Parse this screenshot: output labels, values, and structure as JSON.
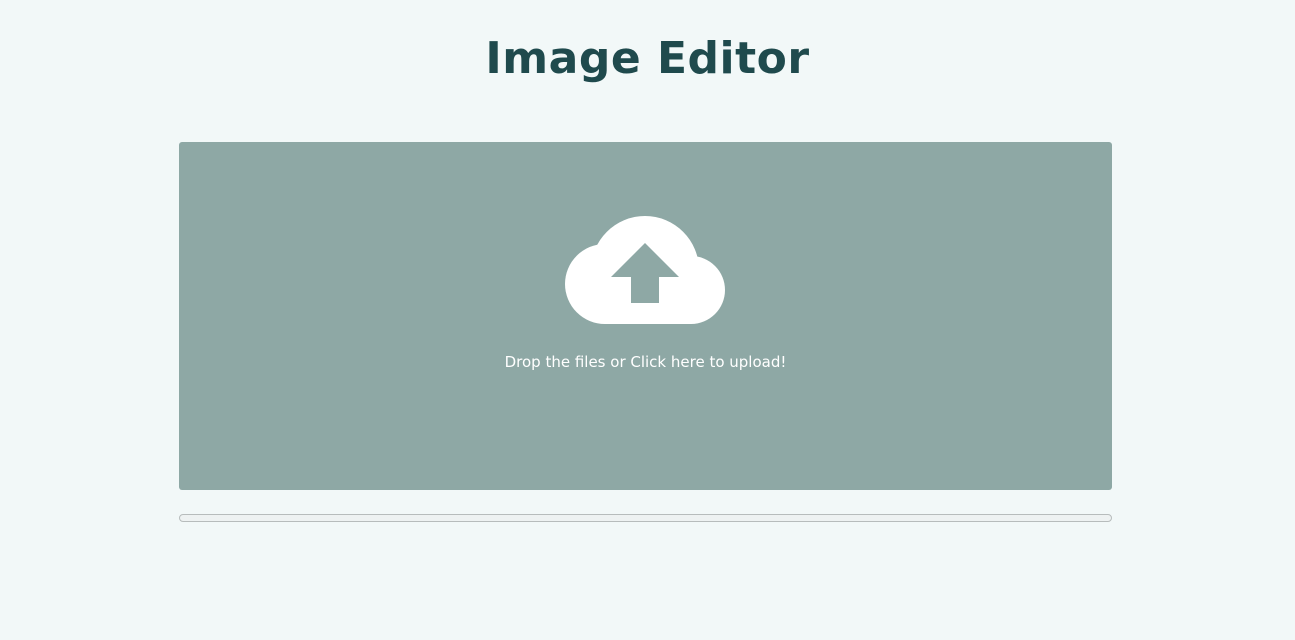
{
  "header": {
    "title": "Image Editor"
  },
  "dropzone": {
    "icon": "cloud-upload-icon",
    "text": "Drop the files or Click here to upload!"
  },
  "upload_progress": {
    "fraction": 0
  },
  "colors": {
    "background": "#f2f8f8",
    "title": "#1f4a4d",
    "dropzone": "#8ea8a5",
    "dropzone_text": "#ffffff"
  }
}
